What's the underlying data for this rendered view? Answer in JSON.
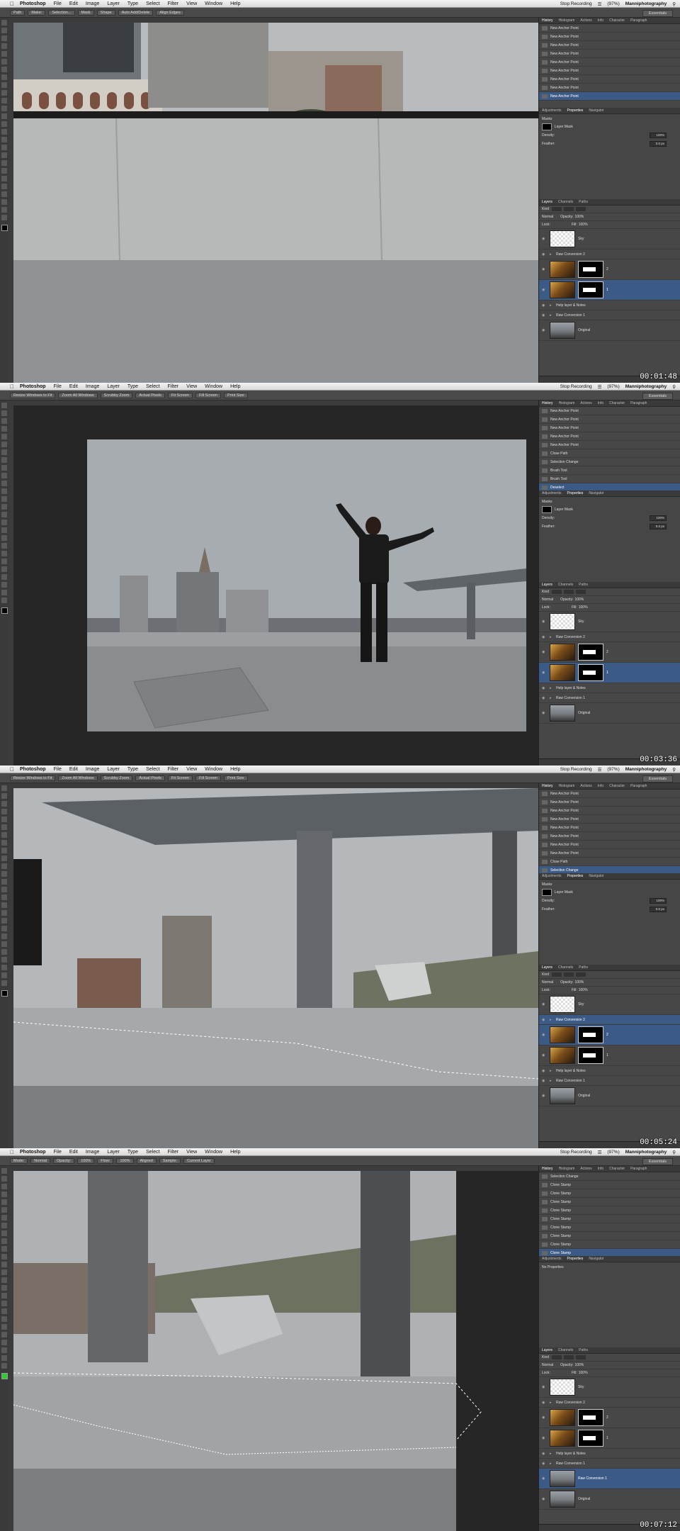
{
  "menu": {
    "items": [
      "Photoshop",
      "File",
      "Edit",
      "Image",
      "Layer",
      "Type",
      "Select",
      "Filter",
      "View",
      "Window",
      "Help"
    ],
    "status": {
      "recording": "Stop Recording",
      "battery": "(97%)",
      "user": "Manniphotography"
    }
  },
  "panels": {
    "history_tabs": [
      "History",
      "Histogram",
      "Actions",
      "Info",
      "Character",
      "Paragraph"
    ],
    "properties_tabs": [
      "Adjustments",
      "Properties",
      "Navigator"
    ],
    "layers_tabs": [
      "Layers",
      "Channels",
      "Paths"
    ],
    "props": {
      "masks_title": "Masks",
      "layer_mask": "Layer Mask",
      "density": "Density:",
      "density_value": "100%",
      "feather": "Feather:",
      "feather_value": "0.0 px",
      "no_properties": "No Properties"
    },
    "layer_controls": {
      "kind": "Kind",
      "blend": "Normal",
      "opacity": "Opacity:",
      "lock": "Lock:",
      "fill": "Fill:",
      "opacity_value": "100%",
      "fill_value": "100%"
    },
    "workspace": "Essentials"
  },
  "frames": [
    {
      "timecode": "00:01:48",
      "options": [
        "Path",
        "Make:",
        "Selection...",
        "Mask",
        "Shape",
        "Auto Add/Delete",
        "Align Edges"
      ],
      "history": [
        "New Anchor Point",
        "New Anchor Point",
        "New Anchor Point",
        "New Anchor Point",
        "New Anchor Point",
        "New Anchor Point",
        "New Anchor Point",
        "New Anchor Point",
        "New Anchor Point"
      ],
      "layers": [
        {
          "name": "Sky",
          "kind": "check"
        },
        {
          "name": "Raw Conversion 2",
          "kind": "group"
        },
        {
          "name": "2",
          "kind": "mask"
        },
        {
          "name": "1",
          "kind": "mask-sel"
        },
        {
          "name": "Help layer & Notes",
          "kind": "group"
        },
        {
          "name": "Raw Conversion 1",
          "kind": "group"
        },
        {
          "name": "Original",
          "kind": "orig"
        }
      ]
    },
    {
      "timecode": "00:03:36",
      "options": [
        "Resize Windows to Fit",
        "Zoom All Windows",
        "Scrubby Zoom",
        "Actual Pixels",
        "Fit Screen",
        "Fill Screen",
        "Print Size"
      ],
      "history": [
        "New Anchor Point",
        "New Anchor Point",
        "New Anchor Point",
        "New Anchor Point",
        "New Anchor Point",
        "Close Path",
        "Selection Change",
        "Brush Tool",
        "Brush Tool",
        "Deselect"
      ],
      "layers": [
        {
          "name": "Sky",
          "kind": "check"
        },
        {
          "name": "Raw Conversion 2",
          "kind": "group"
        },
        {
          "name": "2",
          "kind": "mask"
        },
        {
          "name": "1",
          "kind": "mask-sel"
        },
        {
          "name": "Help layer & Notes",
          "kind": "group"
        },
        {
          "name": "Raw Conversion 1",
          "kind": "group"
        },
        {
          "name": "Original",
          "kind": "orig"
        }
      ]
    },
    {
      "timecode": "00:05:24",
      "options": [
        "Resize Windows to Fit",
        "Zoom All Windows",
        "Scrubby Zoom",
        "Actual Pixels",
        "Fit Screen",
        "Fill Screen",
        "Print Size"
      ],
      "history": [
        "New Anchor Point",
        "New Anchor Point",
        "New Anchor Point",
        "New Anchor Point",
        "New Anchor Point",
        "New Anchor Point",
        "New Anchor Point",
        "New Anchor Point",
        "Close Path",
        "Selection Change"
      ],
      "layers": [
        {
          "name": "Sky",
          "kind": "check"
        },
        {
          "name": "Raw Conversion 2",
          "kind": "group-sel"
        },
        {
          "name": "2",
          "kind": "mask-sel"
        },
        {
          "name": "1",
          "kind": "mask"
        },
        {
          "name": "Help layer & Notes",
          "kind": "group"
        },
        {
          "name": "Raw Conversion 1",
          "kind": "group"
        },
        {
          "name": "Original",
          "kind": "orig"
        }
      ]
    },
    {
      "timecode": "00:07:12",
      "options": [
        "Mode:",
        "Normal",
        "Opacity:",
        "100%",
        "Flow:",
        "100%",
        "Aligned",
        "Sample:",
        "Current Layer"
      ],
      "history": [
        "Selection Change",
        "Clone Stamp",
        "Clone Stamp",
        "Clone Stamp",
        "Clone Stamp",
        "Clone Stamp",
        "Clone Stamp",
        "Clone Stamp",
        "Clone Stamp",
        "Clone Stamp"
      ],
      "layers": [
        {
          "name": "Sky",
          "kind": "check"
        },
        {
          "name": "Raw Conversion 2",
          "kind": "group"
        },
        {
          "name": "2",
          "kind": "mask"
        },
        {
          "name": "1",
          "kind": "mask"
        },
        {
          "name": "Help layer & Notes",
          "kind": "group"
        },
        {
          "name": "Raw Conversion 1",
          "kind": "group"
        },
        {
          "name": "Raw Conversion 1",
          "kind": "orig-sel"
        },
        {
          "name": "Original",
          "kind": "orig"
        }
      ]
    }
  ]
}
